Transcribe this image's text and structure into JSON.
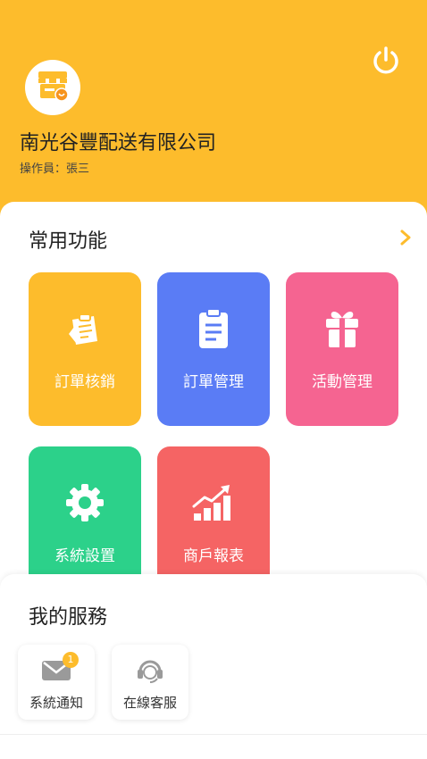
{
  "header": {
    "company_name": "南光谷豐配送有限公司",
    "operator_label": "操作員：張三",
    "logo_icon": "store-icon",
    "power_icon": "power-icon"
  },
  "common_functions": {
    "title": "常用功能",
    "more_icon": "chevron-right-icon",
    "tiles": [
      {
        "label": "訂單核銷",
        "icon": "clipboard-pen-icon",
        "color": "#FDBC2C"
      },
      {
        "label": "訂單管理",
        "icon": "clipboard-list-icon",
        "color": "#5A7CF5"
      },
      {
        "label": "活動管理",
        "icon": "gift-icon",
        "color": "#F56491"
      },
      {
        "label": "系統設置",
        "icon": "gear-icon",
        "color": "#2CD18A"
      },
      {
        "label": "商戶報表",
        "icon": "bar-chart-icon",
        "color": "#F56464"
      }
    ]
  },
  "my_services": {
    "title": "我的服務",
    "items": [
      {
        "label": "系統通知",
        "icon": "mail-icon",
        "badge": "1"
      },
      {
        "label": "在線客服",
        "icon": "headset-icon"
      }
    ]
  },
  "colors": {
    "accent": "#FDBC2C"
  }
}
